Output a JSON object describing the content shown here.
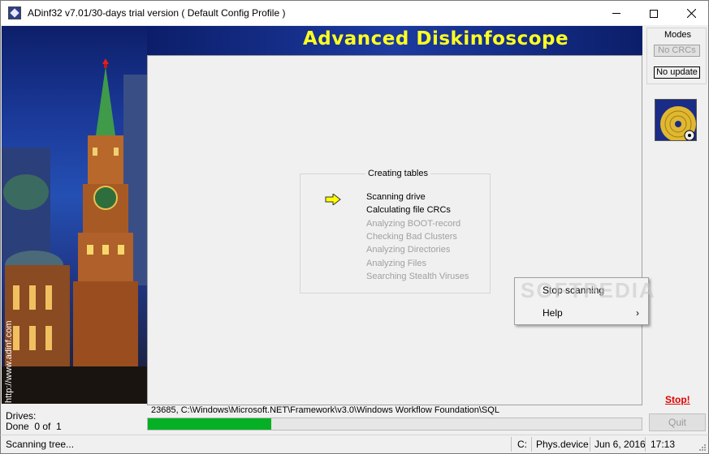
{
  "window": {
    "title": "ADinf32 v7.01/30-days trial version ( Default Config Profile )",
    "minimize_glyph": "—",
    "maximize_glyph": "☐",
    "close_glyph": "✕"
  },
  "banner": {
    "title": "Advanced Diskinfoscope",
    "url": "http://www.adinf.com"
  },
  "scan": {
    "group_title": "Creating tables",
    "steps": [
      {
        "label": "Scanning drive",
        "state": "active"
      },
      {
        "label": "Calculating file CRCs",
        "state": "active"
      },
      {
        "label": "Analyzing BOOT-record",
        "state": "inactive"
      },
      {
        "label": "Checking Bad Clusters",
        "state": "inactive"
      },
      {
        "label": "Analyzing Directories",
        "state": "inactive"
      },
      {
        "label": "Analyzing Files",
        "state": "inactive"
      },
      {
        "label": "Searching Stealth Viruses",
        "state": "inactive"
      }
    ],
    "current_path": "23685, C:\\Windows\\Microsoft.NET\\Framework\\v3.0\\Windows Workflow Foundation\\SQL",
    "progress_fraction": 0.25
  },
  "drives": {
    "label": "Drives:",
    "done": "Done  0 of  1"
  },
  "modes": {
    "title": "Modes",
    "no_crcs": "No CRCs",
    "no_update": "No update"
  },
  "actions": {
    "stop": "Stop!",
    "quit": "Quit"
  },
  "context_menu": {
    "items": [
      {
        "label": "Stop scanning"
      },
      {
        "label": "Help",
        "submenu_glyph": "›"
      }
    ],
    "watermark": "SOFTPEDIA"
  },
  "statusbar": {
    "message": "Scanning tree...",
    "drive": "C:",
    "device": "Phys.device",
    "date": "Jun 6, 2016",
    "time": "17:13"
  },
  "colors": {
    "banner_text": "#ffff22",
    "progress": "#06b025",
    "stop": "#e00000",
    "active_arrow": "#ffff00"
  }
}
